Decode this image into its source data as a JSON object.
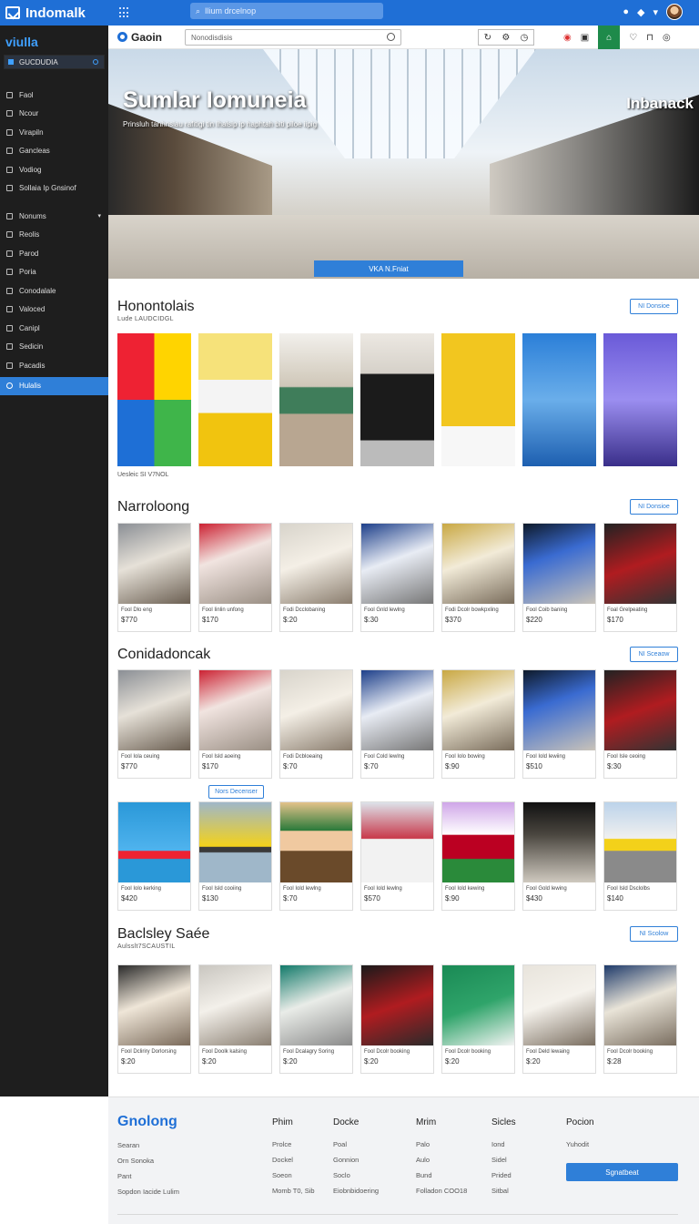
{
  "app": {
    "title": "Indomalk"
  },
  "topbar": {
    "search_placeholder": "Ilium drcelnop"
  },
  "sidebar": {
    "title": "viulla",
    "active": "GUCDUDIA",
    "group1": [
      {
        "label": "Faol",
        "icon": "home-icon"
      },
      {
        "label": "Ncour",
        "icon": "circle-icon"
      },
      {
        "label": "Virapiln",
        "icon": "circle-icon"
      },
      {
        "label": "Gancleas",
        "icon": "folder-icon"
      },
      {
        "label": "Vodiog",
        "icon": "chart-icon"
      },
      {
        "label": "Sollaia Ip Gnsinof",
        "icon": "gear-icon"
      }
    ],
    "group2": [
      {
        "label": "Nonums",
        "icon": "list-icon"
      },
      {
        "label": "Reolis",
        "icon": "tag-icon"
      },
      {
        "label": "Parod",
        "icon": "box-icon"
      },
      {
        "label": "Poria",
        "icon": "page-icon"
      },
      {
        "label": "Conodalale",
        "icon": "square-icon"
      },
      {
        "label": "Valoced",
        "icon": "square-icon"
      },
      {
        "label": "Canipl",
        "icon": "square-icon"
      },
      {
        "label": "Sedicin",
        "icon": "square-icon"
      },
      {
        "label": "Pacadis",
        "icon": "gear-icon"
      }
    ],
    "selected": "Hulalis"
  },
  "subbar": {
    "logo": "Gaoin",
    "search_placeholder": "Nonodisdisis"
  },
  "hero": {
    "title": "Sumlar Iomuneia",
    "subtitle": "Prinsluh tanhnsiau rafitigi tin Ihalsip ip haphtah biti piloe iipig",
    "brand": "Inbanack",
    "button": "VKA N.Fniat"
  },
  "sections": {
    "s1": {
      "title": "Honontolais",
      "subtitle": "Lude LAUDCIDGL",
      "button": "NI Donsioe",
      "caption": "Uesleic SI V7NOL"
    },
    "s2": {
      "title": "Narroloong",
      "button": "NI Donsioe",
      "items": [
        {
          "label": "Fool Dlo eng",
          "price": "$770"
        },
        {
          "label": "Fool Iinlin unfong",
          "price": "$170"
        },
        {
          "label": "Fodi Dcclobaning",
          "price": "$:20"
        },
        {
          "label": "Fool Gnld lewlng",
          "price": "$:30"
        },
        {
          "label": "Fodi Dcolr bowkpxling",
          "price": "$370"
        },
        {
          "label": "Fool Coib baning",
          "price": "$220"
        },
        {
          "label": "Foal Grelpeating",
          "price": "$170"
        }
      ]
    },
    "s3": {
      "title": "Conidadoncak",
      "button": "NI Sceaow",
      "mid_button": "Nors Decenser",
      "items": [
        {
          "label": "Fool Iola ceuing",
          "price": "$770"
        },
        {
          "label": "Fool Isld aoeing",
          "price": "$170"
        },
        {
          "label": "Fodi Dcbloeaing",
          "price": "$:70"
        },
        {
          "label": "Fool Cold lewlng",
          "price": "$:70"
        },
        {
          "label": "Fool Iolo bowing",
          "price": "$:90"
        },
        {
          "label": "Fool Iold lewiing",
          "price": "$510"
        },
        {
          "label": "Fool Isle ceoing",
          "price": "$:30"
        }
      ],
      "items2": [
        {
          "label": "Fool Iolo kerking",
          "price": "$420"
        },
        {
          "label": "Fool Isld cooiing",
          "price": "$130"
        },
        {
          "label": "Fool Iold lewlng",
          "price": "$:70"
        },
        {
          "label": "Fool Iold lewlng",
          "price": "$570"
        },
        {
          "label": "Fool Iold kewing",
          "price": "$:90"
        },
        {
          "label": "Fool Gold lewing",
          "price": "$430"
        },
        {
          "label": "Fool Isld Dsclolbs",
          "price": "$140"
        }
      ]
    },
    "s4": {
      "title": "Baclsley Saée",
      "subtitle": "Aulsslt7SCAUSTIL",
      "button": "NI Scolow",
      "items": [
        {
          "label": "Fool Dcliriry Dorlorsing",
          "price": "$:20"
        },
        {
          "label": "Fool Doolk kalsing",
          "price": "$:20"
        },
        {
          "label": "Fool Dcalagry Soring",
          "price": "$:20"
        },
        {
          "label": "Fool Dcolr booking",
          "price": "$:20"
        },
        {
          "label": "Fool Dcolr booking",
          "price": "$:20"
        },
        {
          "label": "Fool Deld lewaing",
          "price": "$:20"
        },
        {
          "label": "Fool Dcolr booking",
          "price": "$:28"
        }
      ]
    }
  },
  "footer": {
    "logo": "Gnolong",
    "col0": [
      "Searan",
      "Orn Sonoka",
      "Pant",
      "Sopdon Iacide Lulim"
    ],
    "col1": {
      "h": "Phim",
      "items": [
        "Prolce",
        "Dockel",
        "Soeon",
        "Momb T0, Sib"
      ]
    },
    "col2": {
      "h": "Docke",
      "items": [
        "Poal",
        "Gonnion",
        "Soclo",
        "Eiobnbidoering"
      ]
    },
    "col3": {
      "h": "Mrim",
      "items": [
        "Palo",
        "Aulo",
        "Bund",
        "Folladon COO18"
      ]
    },
    "col4": {
      "h": "Sicles",
      "items": [
        "Iond",
        "Sidel",
        "Prided",
        "Sitbal"
      ]
    },
    "col5": {
      "h": "Pocion",
      "items": [
        "Yuhodit"
      ]
    },
    "button": "Sgnatbeat"
  }
}
